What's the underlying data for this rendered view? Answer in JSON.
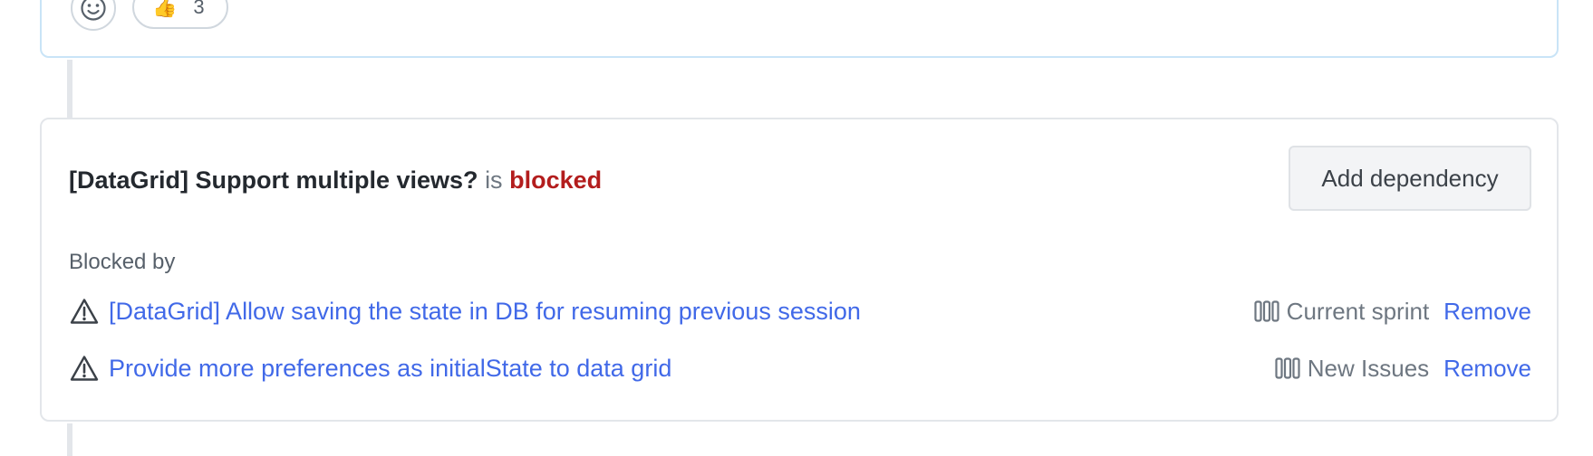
{
  "reactions": {
    "add_reaction_icon": "smiley-icon",
    "thumbs_up": {
      "emoji": "👍",
      "count": "3"
    }
  },
  "dependency": {
    "issue_title": "[DataGrid] Support multiple views?",
    "is_word": "is",
    "status": "blocked",
    "add_button_label": "Add dependency",
    "blocked_by_label": "Blocked by",
    "items": [
      {
        "title": "[DataGrid] Allow saving the state in DB for resuming previous session",
        "icon": "warning-icon",
        "project_icon": "project-board-icon",
        "project": "Current sprint",
        "remove_label": "Remove"
      },
      {
        "title": "Provide more preferences as initialState to data grid",
        "icon": "warning-icon",
        "project_icon": "project-board-icon",
        "project": "New Issues",
        "remove_label": "Remove"
      }
    ]
  },
  "colors": {
    "link": "#4169e8",
    "blocked": "#b31d1d",
    "muted": "#6e7781",
    "comment_border": "#c9e4f7"
  }
}
